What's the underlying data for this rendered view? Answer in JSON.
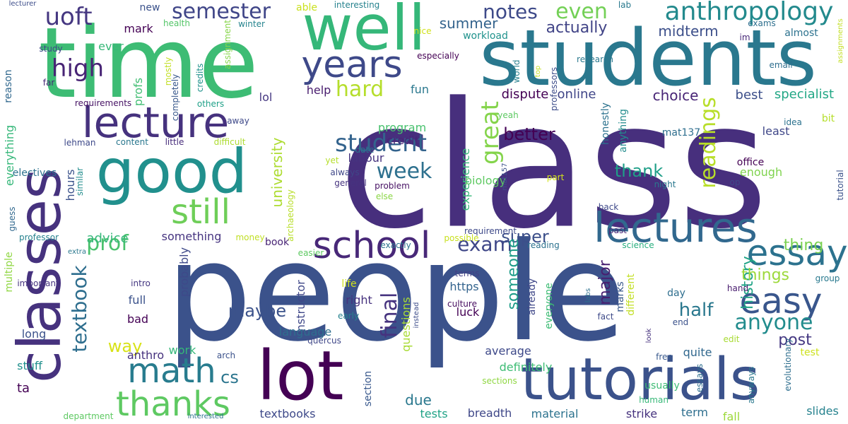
{
  "words": [
    {
      "text": "class",
      "color": "#472f7d"
    },
    {
      "text": "people",
      "color": "#3b528b"
    },
    {
      "text": "students",
      "color": "#2a788e"
    },
    {
      "text": "time",
      "color": "#3dbc74"
    },
    {
      "text": "well",
      "color": "#35b779"
    },
    {
      "text": "classes",
      "color": "#46327e"
    },
    {
      "text": "good",
      "color": "#21908d"
    },
    {
      "text": "lot",
      "color": "#440154"
    },
    {
      "text": "tutorials",
      "color": "#3b528b"
    },
    {
      "text": "lecture",
      "color": "#46327e"
    },
    {
      "text": "lectures",
      "color": "#31688e"
    },
    {
      "text": "years",
      "color": "#3e4989"
    },
    {
      "text": "still",
      "color": "#6ece58"
    },
    {
      "text": "school",
      "color": "#482878"
    },
    {
      "text": "essay",
      "color": "#2c728e"
    },
    {
      "text": "easy",
      "color": "#39568c"
    },
    {
      "text": "math",
      "color": "#287c8e"
    },
    {
      "text": "thanks",
      "color": "#5ec962"
    },
    {
      "text": "anthropology",
      "color": "#238a8d"
    },
    {
      "text": "high",
      "color": "#482475"
    },
    {
      "text": "uoft",
      "color": "#453781"
    },
    {
      "text": "semester",
      "color": "#404688"
    },
    {
      "text": "notes",
      "color": "#3e4a89"
    },
    {
      "text": "even",
      "color": "#73d056"
    },
    {
      "text": "hard",
      "color": "#b5de2b"
    },
    {
      "text": "student",
      "color": "#33638d"
    },
    {
      "text": "week",
      "color": "#2d708e"
    },
    {
      "text": "great",
      "color": "#84d44b"
    },
    {
      "text": "readings",
      "color": "#b8de29"
    },
    {
      "text": "prof",
      "color": "#4ac16d"
    },
    {
      "text": "exam",
      "color": "#3f4788"
    },
    {
      "text": "anyone",
      "color": "#228c8d"
    },
    {
      "text": "final",
      "color": "#46337f"
    },
    {
      "text": "textbook",
      "color": "#2e6e8e"
    },
    {
      "text": "cs",
      "color": "#2b758e"
    },
    {
      "text": "maybe",
      "color": "#3b528b"
    },
    {
      "text": "half",
      "color": "#2a788e"
    },
    {
      "text": "thank",
      "color": "#1f9f88"
    },
    {
      "text": "better",
      "color": "#440154"
    },
    {
      "text": "history",
      "color": "#20a386"
    },
    {
      "text": "super",
      "color": "#3c4f8a"
    },
    {
      "text": "major",
      "color": "#481f70"
    },
    {
      "text": "post",
      "color": "#453882"
    },
    {
      "text": "things",
      "color": "#9dd93b"
    },
    {
      "text": "thing",
      "color": "#7ad151"
    },
    {
      "text": "someone",
      "color": "#1e9c89"
    },
    {
      "text": "actually",
      "color": "#414487"
    },
    {
      "text": "midterm",
      "color": "#3c4f8a"
    },
    {
      "text": "summer",
      "color": "#33638d"
    },
    {
      "text": "university",
      "color": "#addc30"
    },
    {
      "text": "way",
      "color": "#d8e219"
    },
    {
      "text": "due",
      "color": "#2a788e"
    },
    {
      "text": "choice",
      "color": "#482576"
    },
    {
      "text": "best",
      "color": "#3c4f8a"
    },
    {
      "text": "specialist",
      "color": "#22a785"
    },
    {
      "text": "online",
      "color": "#404688"
    },
    {
      "text": "dispute",
      "color": "#440154"
    },
    {
      "text": "help",
      "color": "#481c6e"
    },
    {
      "text": "fun",
      "color": "#2a788e"
    },
    {
      "text": "program",
      "color": "#48c16e"
    },
    {
      "text": "credit",
      "color": "#482677"
    },
    {
      "text": "biology",
      "color": "#5ec962"
    },
    {
      "text": "experience",
      "color": "#35b779"
    },
    {
      "text": "labour",
      "color": "#46337f"
    },
    {
      "text": "advice",
      "color": "#35b779"
    },
    {
      "text": "something",
      "color": "#463480"
    },
    {
      "text": "probably",
      "color": "#3e4989"
    },
    {
      "text": "hours",
      "color": "#3b528b"
    },
    {
      "text": "profs",
      "color": "#40bd72"
    },
    {
      "text": "everything",
      "color": "#35b779"
    },
    {
      "text": "lol",
      "color": "#453781"
    },
    {
      "text": "ever",
      "color": "#37b878"
    },
    {
      "text": "mark",
      "color": "#440154"
    },
    {
      "text": "new",
      "color": "#3b528b"
    },
    {
      "text": "able",
      "color": "#cae11f"
    },
    {
      "text": "interesting",
      "color": "#26828e"
    },
    {
      "text": "lab",
      "color": "#29798e"
    },
    {
      "text": "exams",
      "color": "#2e6f8e"
    },
    {
      "text": "almost",
      "color": "#2c728e"
    },
    {
      "text": "im",
      "color": "#482878"
    },
    {
      "text": "research",
      "color": "#2a788e"
    },
    {
      "text": "especially",
      "color": "#440154"
    },
    {
      "text": "workload",
      "color": "#20928c"
    },
    {
      "text": "nice",
      "color": "#d0e11c"
    },
    {
      "text": "winter",
      "color": "#25848e"
    },
    {
      "text": "health",
      "color": "#54c568"
    },
    {
      "text": "study",
      "color": "#3f4788"
    },
    {
      "text": "reason",
      "color": "#31688e"
    },
    {
      "text": "far",
      "color": "#482677"
    },
    {
      "text": "requirements",
      "color": "#471365"
    },
    {
      "text": "assignment",
      "color": "#86d549"
    },
    {
      "text": "credits",
      "color": "#20928c"
    },
    {
      "text": "completely",
      "color": "#38588c"
    },
    {
      "text": "mostly",
      "color": "#c2df23"
    },
    {
      "text": "others",
      "color": "#1fa088"
    },
    {
      "text": "away",
      "color": "#3e4989"
    },
    {
      "text": "lehman",
      "color": "#3e4989"
    },
    {
      "text": "content",
      "color": "#2a778e"
    },
    {
      "text": "little",
      "color": "#472d7b"
    },
    {
      "text": "difficult",
      "color": "#addc30"
    },
    {
      "text": "electives",
      "color": "#2c728e"
    },
    {
      "text": "similar",
      "color": "#228d8d"
    },
    {
      "text": "date",
      "color": "#2c728e"
    },
    {
      "text": "yet",
      "color": "#b5de2b"
    },
    {
      "text": "always",
      "color": "#3f4788"
    },
    {
      "text": "general",
      "color": "#46337f"
    },
    {
      "text": "else",
      "color": "#8bd646"
    },
    {
      "text": "problem",
      "color": "#471164"
    },
    {
      "text": "guess",
      "color": "#31688e"
    },
    {
      "text": "professor",
      "color": "#26828e"
    },
    {
      "text": "archaeology",
      "color": "#b8de29"
    },
    {
      "text": "requirement",
      "color": "#3e4989"
    },
    {
      "text": "money",
      "color": "#c0df25"
    },
    {
      "text": "multiple",
      "color": "#90d743"
    },
    {
      "text": "important",
      "color": "#46337f"
    },
    {
      "text": "extra",
      "color": "#2a788e"
    },
    {
      "text": "intro",
      "color": "#453781"
    },
    {
      "text": "book",
      "color": "#482475"
    },
    {
      "text": "easier",
      "color": "#5ec962"
    },
    {
      "text": "exactly",
      "color": "#2c728e"
    },
    {
      "text": "possible",
      "color": "#c8e020"
    },
    {
      "text": "reading",
      "color": "#2c728e"
    },
    {
      "text": "science",
      "color": "#29af7f"
    },
    {
      "text": "world",
      "color": "#277f8e"
    },
    {
      "text": "top",
      "color": "#c2df23"
    },
    {
      "text": "professors",
      "color": "#3d4d8a"
    },
    {
      "text": "yeah",
      "color": "#5ec962"
    },
    {
      "text": "part",
      "color": "#d2e21b"
    },
    {
      "text": "idea",
      "color": "#2c728e"
    },
    {
      "text": "email",
      "color": "#2e6e8e"
    },
    {
      "text": "bit",
      "color": "#b5de2b"
    },
    {
      "text": "least",
      "color": "#3f4788"
    },
    {
      "text": "office",
      "color": "#440154"
    },
    {
      "text": "enough",
      "color": "#7fd34e"
    },
    {
      "text": "op",
      "color": "#3e4989"
    },
    {
      "text": "tutorial",
      "color": "#3b528b"
    },
    {
      "text": "night",
      "color": "#2a788e"
    },
    {
      "text": "back",
      "color": "#3e4989"
    },
    {
      "text": "past",
      "color": "#482677"
    },
    {
      "text": "honestly",
      "color": "#2c728e"
    },
    {
      "text": "anything",
      "color": "#228c8d"
    },
    {
      "text": "mat137",
      "color": "#2e6e8e"
    },
    {
      "text": "mat157",
      "color": "#3b528b"
    },
    {
      "text": "terms",
      "color": "#424086"
    },
    {
      "text": "life",
      "color": "#d0e11c"
    },
    {
      "text": "right",
      "color": "#46327e"
    },
    {
      "text": "https",
      "color": "#33638d"
    },
    {
      "text": "questions",
      "color": "#a8db34"
    },
    {
      "text": "instead",
      "color": "#3d4d8a"
    },
    {
      "text": "culture",
      "color": "#470d60"
    },
    {
      "text": "luck",
      "color": "#440154"
    },
    {
      "text": "early",
      "color": "#26828e"
    },
    {
      "text": "already",
      "color": "#3f4788"
    },
    {
      "text": "everyone",
      "color": "#3dbc74"
    },
    {
      "text": "marks",
      "color": "#38588c"
    },
    {
      "text": "different",
      "color": "#c2df23"
    },
    {
      "text": "labs",
      "color": "#2d708e"
    },
    {
      "text": "fact",
      "color": "#3e4a89"
    },
    {
      "text": "day",
      "color": "#2e6e8e"
    },
    {
      "text": "end",
      "color": "#3b528b"
    },
    {
      "text": "hand",
      "color": "#481c6e"
    },
    {
      "text": "group",
      "color": "#29798e"
    },
    {
      "text": "look",
      "color": "#46327e"
    },
    {
      "text": "instructor",
      "color": "#3f4788"
    },
    {
      "text": "language",
      "color": "#2e6e8e"
    },
    {
      "text": "average",
      "color": "#3e4989"
    },
    {
      "text": "definitely",
      "color": "#3dbc74"
    },
    {
      "text": "quite",
      "color": "#31688e"
    },
    {
      "text": "edit",
      "color": "#a8db34"
    },
    {
      "text": "evolutionary",
      "color": "#2e6e8e"
    },
    {
      "text": "test",
      "color": "#cde11d"
    },
    {
      "text": "anyways",
      "color": "#2a788e"
    },
    {
      "text": "essays",
      "color": "#2e6e8e"
    },
    {
      "text": "usually",
      "color": "#3dbc74"
    },
    {
      "text": "free",
      "color": "#38588c"
    },
    {
      "text": "human",
      "color": "#37b878"
    },
    {
      "text": "work",
      "color": "#35b779"
    },
    {
      "text": "anthro",
      "color": "#46327e"
    },
    {
      "text": "bad",
      "color": "#440154"
    },
    {
      "text": "full",
      "color": "#3b528b"
    },
    {
      "text": "long",
      "color": "#3b528b"
    },
    {
      "text": "stuff",
      "color": "#21908d"
    },
    {
      "text": "ta",
      "color": "#440154"
    },
    {
      "text": "arch",
      "color": "#3b528b"
    },
    {
      "text": "quercus",
      "color": "#3f4788"
    },
    {
      "text": "section",
      "color": "#38588c"
    },
    {
      "text": "sections",
      "color": "#90d743"
    },
    {
      "text": "tests",
      "color": "#20a386"
    },
    {
      "text": "breadth",
      "color": "#3f4788"
    },
    {
      "text": "material",
      "color": "#2c728e"
    },
    {
      "text": "textbooks",
      "color": "#3e4989"
    },
    {
      "text": "strike",
      "color": "#46327e"
    },
    {
      "text": "term",
      "color": "#2e6e8e"
    },
    {
      "text": "fall",
      "color": "#9dd93b"
    },
    {
      "text": "slides",
      "color": "#26828e"
    },
    {
      "text": "department",
      "color": "#5ec962"
    },
    {
      "text": "interested",
      "color": "#2c728e"
    },
    {
      "text": "lecturer",
      "color": "#3d4d8a"
    },
    {
      "text": "assignments",
      "color": "#c2df23"
    }
  ]
}
